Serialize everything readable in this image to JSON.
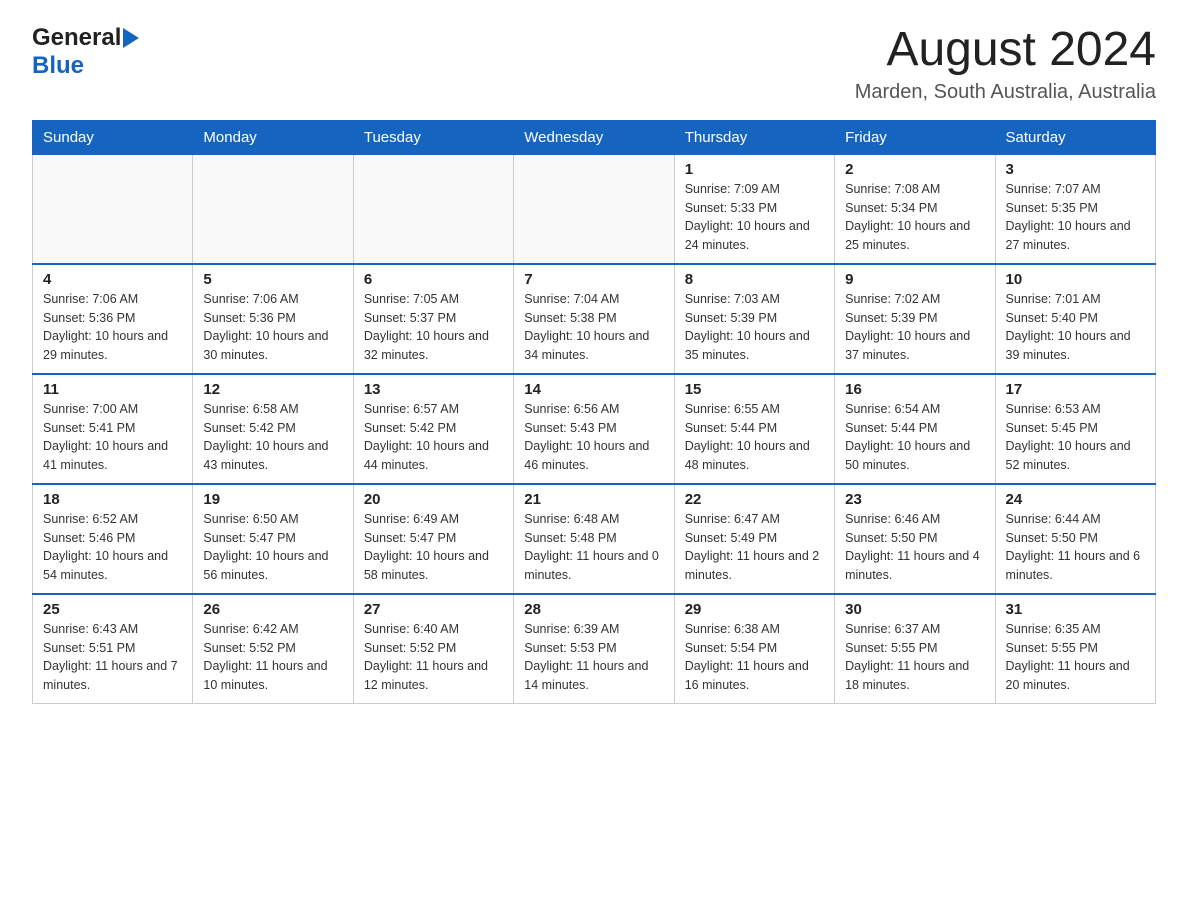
{
  "header": {
    "logo": {
      "line1": "General",
      "line2": "Blue"
    },
    "title": "August 2024",
    "location": "Marden, South Australia, Australia"
  },
  "days_of_week": [
    "Sunday",
    "Monday",
    "Tuesday",
    "Wednesday",
    "Thursday",
    "Friday",
    "Saturday"
  ],
  "weeks": [
    {
      "days": [
        {
          "number": "",
          "info": ""
        },
        {
          "number": "",
          "info": ""
        },
        {
          "number": "",
          "info": ""
        },
        {
          "number": "",
          "info": ""
        },
        {
          "number": "1",
          "info": "Sunrise: 7:09 AM\nSunset: 5:33 PM\nDaylight: 10 hours and 24 minutes."
        },
        {
          "number": "2",
          "info": "Sunrise: 7:08 AM\nSunset: 5:34 PM\nDaylight: 10 hours and 25 minutes."
        },
        {
          "number": "3",
          "info": "Sunrise: 7:07 AM\nSunset: 5:35 PM\nDaylight: 10 hours and 27 minutes."
        }
      ]
    },
    {
      "days": [
        {
          "number": "4",
          "info": "Sunrise: 7:06 AM\nSunset: 5:36 PM\nDaylight: 10 hours and 29 minutes."
        },
        {
          "number": "5",
          "info": "Sunrise: 7:06 AM\nSunset: 5:36 PM\nDaylight: 10 hours and 30 minutes."
        },
        {
          "number": "6",
          "info": "Sunrise: 7:05 AM\nSunset: 5:37 PM\nDaylight: 10 hours and 32 minutes."
        },
        {
          "number": "7",
          "info": "Sunrise: 7:04 AM\nSunset: 5:38 PM\nDaylight: 10 hours and 34 minutes."
        },
        {
          "number": "8",
          "info": "Sunrise: 7:03 AM\nSunset: 5:39 PM\nDaylight: 10 hours and 35 minutes."
        },
        {
          "number": "9",
          "info": "Sunrise: 7:02 AM\nSunset: 5:39 PM\nDaylight: 10 hours and 37 minutes."
        },
        {
          "number": "10",
          "info": "Sunrise: 7:01 AM\nSunset: 5:40 PM\nDaylight: 10 hours and 39 minutes."
        }
      ]
    },
    {
      "days": [
        {
          "number": "11",
          "info": "Sunrise: 7:00 AM\nSunset: 5:41 PM\nDaylight: 10 hours and 41 minutes."
        },
        {
          "number": "12",
          "info": "Sunrise: 6:58 AM\nSunset: 5:42 PM\nDaylight: 10 hours and 43 minutes."
        },
        {
          "number": "13",
          "info": "Sunrise: 6:57 AM\nSunset: 5:42 PM\nDaylight: 10 hours and 44 minutes."
        },
        {
          "number": "14",
          "info": "Sunrise: 6:56 AM\nSunset: 5:43 PM\nDaylight: 10 hours and 46 minutes."
        },
        {
          "number": "15",
          "info": "Sunrise: 6:55 AM\nSunset: 5:44 PM\nDaylight: 10 hours and 48 minutes."
        },
        {
          "number": "16",
          "info": "Sunrise: 6:54 AM\nSunset: 5:44 PM\nDaylight: 10 hours and 50 minutes."
        },
        {
          "number": "17",
          "info": "Sunrise: 6:53 AM\nSunset: 5:45 PM\nDaylight: 10 hours and 52 minutes."
        }
      ]
    },
    {
      "days": [
        {
          "number": "18",
          "info": "Sunrise: 6:52 AM\nSunset: 5:46 PM\nDaylight: 10 hours and 54 minutes."
        },
        {
          "number": "19",
          "info": "Sunrise: 6:50 AM\nSunset: 5:47 PM\nDaylight: 10 hours and 56 minutes."
        },
        {
          "number": "20",
          "info": "Sunrise: 6:49 AM\nSunset: 5:47 PM\nDaylight: 10 hours and 58 minutes."
        },
        {
          "number": "21",
          "info": "Sunrise: 6:48 AM\nSunset: 5:48 PM\nDaylight: 11 hours and 0 minutes."
        },
        {
          "number": "22",
          "info": "Sunrise: 6:47 AM\nSunset: 5:49 PM\nDaylight: 11 hours and 2 minutes."
        },
        {
          "number": "23",
          "info": "Sunrise: 6:46 AM\nSunset: 5:50 PM\nDaylight: 11 hours and 4 minutes."
        },
        {
          "number": "24",
          "info": "Sunrise: 6:44 AM\nSunset: 5:50 PM\nDaylight: 11 hours and 6 minutes."
        }
      ]
    },
    {
      "days": [
        {
          "number": "25",
          "info": "Sunrise: 6:43 AM\nSunset: 5:51 PM\nDaylight: 11 hours and 7 minutes."
        },
        {
          "number": "26",
          "info": "Sunrise: 6:42 AM\nSunset: 5:52 PM\nDaylight: 11 hours and 10 minutes."
        },
        {
          "number": "27",
          "info": "Sunrise: 6:40 AM\nSunset: 5:52 PM\nDaylight: 11 hours and 12 minutes."
        },
        {
          "number": "28",
          "info": "Sunrise: 6:39 AM\nSunset: 5:53 PM\nDaylight: 11 hours and 14 minutes."
        },
        {
          "number": "29",
          "info": "Sunrise: 6:38 AM\nSunset: 5:54 PM\nDaylight: 11 hours and 16 minutes."
        },
        {
          "number": "30",
          "info": "Sunrise: 6:37 AM\nSunset: 5:55 PM\nDaylight: 11 hours and 18 minutes."
        },
        {
          "number": "31",
          "info": "Sunrise: 6:35 AM\nSunset: 5:55 PM\nDaylight: 11 hours and 20 minutes."
        }
      ]
    }
  ]
}
